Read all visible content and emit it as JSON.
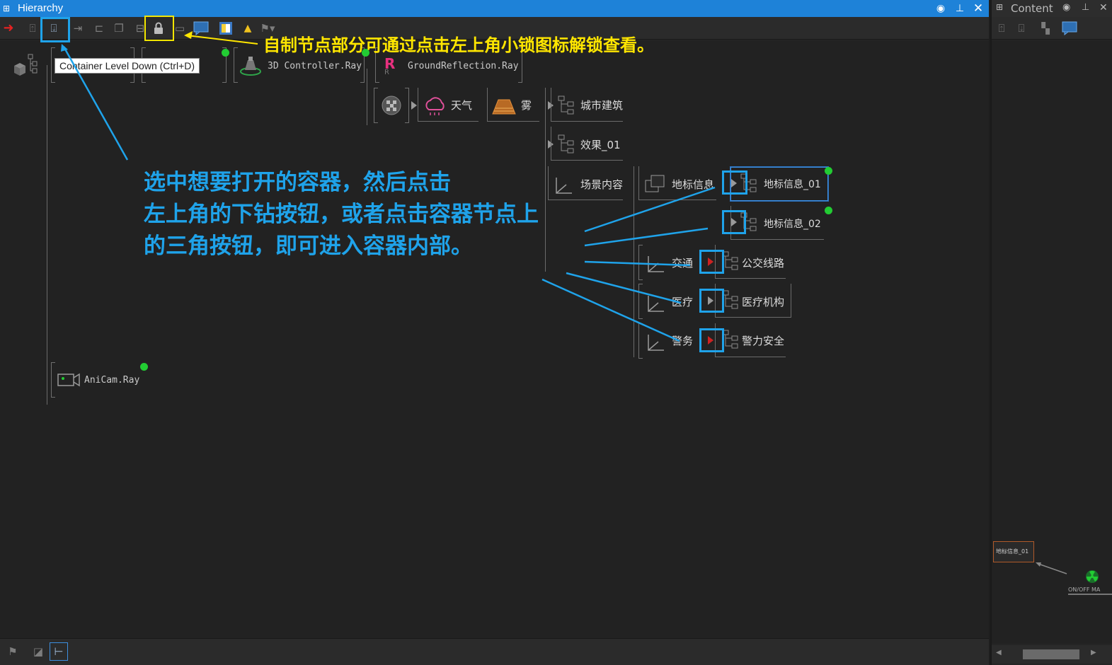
{
  "hierarchy": {
    "title": "Hierarchy",
    "title_icon": "hierarchy-icon",
    "tooltip": "Container Level Down (Ctrl+D)",
    "nodes": {
      "controller": "3D Controller.Ray",
      "ground_reflection": "GroundReflection.Ray",
      "weather": "天气",
      "fog": "雾",
      "city_buildings": "城市建筑",
      "effect_01": "效果_01",
      "scene_content": "场景内容",
      "landmark_info": "地标信息",
      "landmark_info_01": "地标信息_01",
      "landmark_info_02": "地标信息_02",
      "traffic": "交通",
      "bus_lines": "公交线路",
      "medical": "医疗",
      "medical_institution": "医疗机构",
      "police": "警务",
      "police_security": "警力安全",
      "anicam": "AniCam.Ray"
    }
  },
  "annotations": {
    "lock_hint": "自制节点部分可通过点击左上角小锁图标解锁查看。",
    "drill_hint_line1": "选中想要打开的容器，然后点击",
    "drill_hint_line2": "左上角的下钻按钮，或者点击容器节点上",
    "drill_hint_line3": "的三角按钮，即可进入容器内部。"
  },
  "content": {
    "title": "Content",
    "mini_node_label": "地标信息_01",
    "mini_switch_label": "ON/OFF MA"
  },
  "colors": {
    "titlebar": "#1e82d8",
    "annotation_yellow": "#ffe600",
    "annotation_blue": "#1fa3ea",
    "status_green": "#22cc33"
  }
}
